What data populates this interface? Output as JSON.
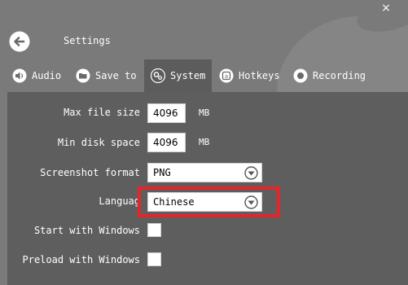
{
  "window": {
    "title": "Settings",
    "close_symbol": "×",
    "back_icon": "arrow-left-circle-icon",
    "colors": {
      "background": "#7a7a7a",
      "panel": "#5e5e5e",
      "highlight": "#e5252a"
    }
  },
  "tabs": [
    {
      "label": "Audio",
      "icon": "speaker-icon",
      "active": false
    },
    {
      "label": "Save to",
      "icon": "folder-icon",
      "active": false
    },
    {
      "label": "System",
      "icon": "gears-icon",
      "active": true
    },
    {
      "label": "Hotkeys",
      "icon": "keyboard-a-icon",
      "active": false
    },
    {
      "label": "Recording",
      "icon": "record-icon",
      "active": false
    }
  ],
  "settings": {
    "max_file_size": {
      "label": "Max file size",
      "value": "4096",
      "unit": "MB"
    },
    "min_disk_space": {
      "label": "Min disk space",
      "value": "4096",
      "unit": "MB"
    },
    "screenshot_format": {
      "label": "Screenshot format",
      "value": "PNG"
    },
    "language": {
      "label": "Languag",
      "value": "Chinese"
    },
    "start_with_windows": {
      "label": "Start with Windows",
      "checked": false
    },
    "preload_with_windows": {
      "label": "Preload with Windows",
      "checked": false
    }
  }
}
